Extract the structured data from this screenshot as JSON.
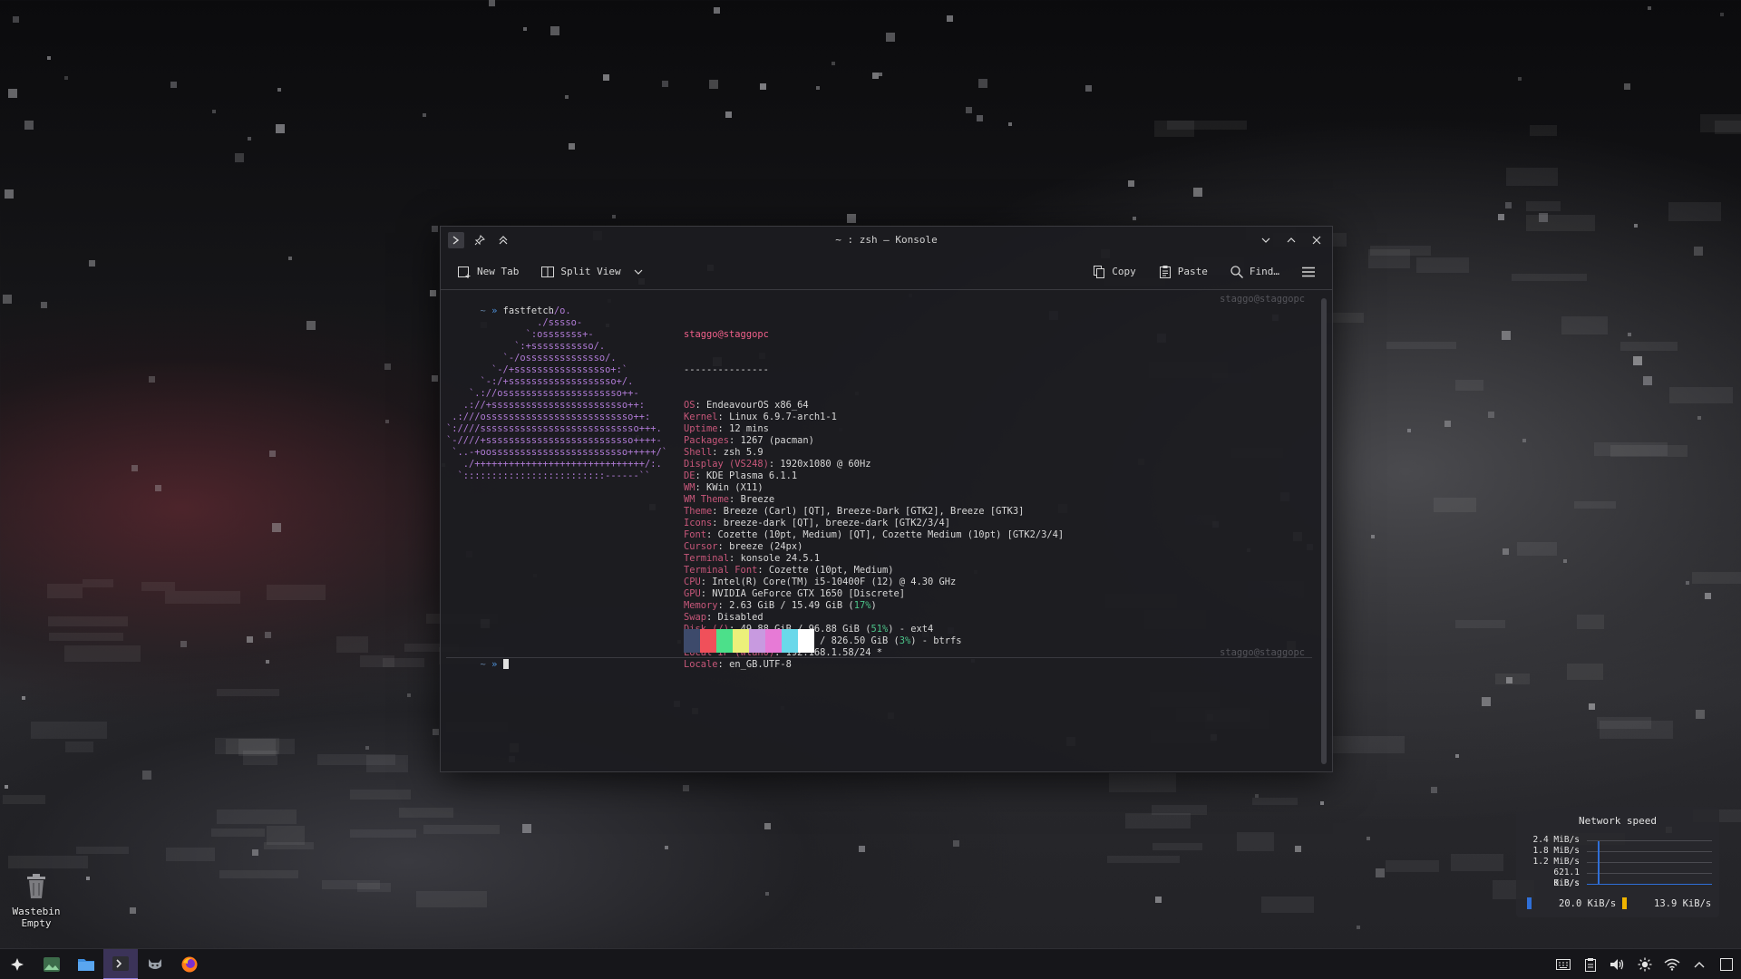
{
  "desktop": {
    "wastebin_label": "Wastebin",
    "wastebin_status": "Empty"
  },
  "window": {
    "title": "~ : zsh — Konsole",
    "toolbar": {
      "new_tab": "New Tab",
      "split_view": "Split View",
      "copy": "Copy",
      "paste": "Paste",
      "find": "Find…"
    }
  },
  "terminal": {
    "prompt_tilde": "~",
    "prompt_arrow": "»",
    "command": "fastfetch",
    "host_right": "staggo@staggopc",
    "logo_lines": [
      "                  ./o.",
      "                ./sssso-",
      "              `:osssssss+-",
      "            `:+sssssssssso/.",
      "          `-/ossssssssssssso/.",
      "        `-/+sssssssssssssssso+:`",
      "      `-:/+sssssssssssssssssso+/.",
      "    `.://osssssssssssssssssssso++-",
      "   .://+ssssssssssssssssssssssso++:",
      " .:///ossssssssssssssssssssssssso++:",
      "`:////ssssssssssssssssssssssssssso+++.",
      "`-////+ssssssssssssssssssssssssso++++-",
      " `..-+oossssssssssssssssssssssso+++++/`",
      "   ./++++++++++++++++++++++++++++++/:.",
      "  `:::::::::::::::::::::::::------``"
    ],
    "user_host": "staggo@staggopc",
    "underline": "---------------",
    "info": [
      {
        "k": "OS",
        "v": "EndeavourOS x86_64"
      },
      {
        "k": "Kernel",
        "v": "Linux 6.9.7-arch1-1"
      },
      {
        "k": "Uptime",
        "v": "12 mins"
      },
      {
        "k": "Packages",
        "v": "1267 (pacman)"
      },
      {
        "k": "Shell",
        "v": "zsh 5.9"
      },
      {
        "k": "Display (VS248)",
        "v": "1920x1080 @ 60Hz"
      },
      {
        "k": "DE",
        "v": "KDE Plasma 6.1.1"
      },
      {
        "k": "WM",
        "v": "KWin (X11)"
      },
      {
        "k": "WM Theme",
        "v": "Breeze"
      },
      {
        "k": "Theme",
        "v": "Breeze (Carl) [QT], Breeze-Dark [GTK2], Breeze [GTK3]"
      },
      {
        "k": "Icons",
        "v": "breeze-dark [QT], breeze-dark [GTK2/3/4]"
      },
      {
        "k": "Font",
        "v": "Cozette (10pt, Medium) [QT], Cozette Medium (10pt) [GTK2/3/4]"
      },
      {
        "k": "Cursor",
        "v": "breeze (24px)"
      },
      {
        "k": "Terminal",
        "v": "konsole 24.5.1"
      },
      {
        "k": "Terminal Font",
        "v": "Cozette (10pt, Medium)"
      },
      {
        "k": "CPU",
        "v": "Intel(R) Core(TM) i5-10400F (12) @ 4.30 GHz"
      },
      {
        "k": "GPU",
        "v": "NVIDIA GeForce GTX 1650 [Discrete]"
      },
      {
        "k": "Memory",
        "v": "2.63 GiB / 15.49 GiB (",
        "p": "17%",
        "after": ")"
      },
      {
        "k": "Swap",
        "v": "Disabled"
      },
      {
        "k": "Disk (/)",
        "v": "49.88 GiB / 96.88 GiB (",
        "p": "51%",
        "after": ") - ext4"
      },
      {
        "k": "Disk (/data)",
        "v": "28.21 GiB / 826.50 GiB (",
        "p": "3%",
        "after": ") - btrfs"
      },
      {
        "k": "Local IP (wlan0)",
        "v": "192.168.1.58/24 *"
      },
      {
        "k": "Locale",
        "v": "en_GB.UTF-8"
      }
    ],
    "palette_colors": [
      "#3d4a6b",
      "#f0505a",
      "#4ce08a",
      "#ecf07a",
      "#c89ae0",
      "#e77ad6",
      "#6ad8ea",
      "#ffffff"
    ]
  },
  "network_widget": {
    "title": "Network speed",
    "y_labels": [
      "2.4 MiB/s",
      "1.8 MiB/s",
      "1.2 MiB/s",
      "621.1 KiB/s",
      "0 B/s"
    ],
    "download": "20.0 KiB/s",
    "upload": "13.9 KiB/s",
    "download_color": "#2f6fd8",
    "upload_color": "#f0b400"
  },
  "taskbar": {
    "apps": [
      "app-launcher-icon",
      "image-viewer-icon",
      "file-manager-icon",
      "konsole-icon",
      "cat-app-icon",
      "firefox-icon"
    ],
    "tray": [
      "keyboard-layout-icon",
      "clipboard-icon",
      "volume-icon",
      "brightness-icon",
      "wifi-icon",
      "tray-expand-icon",
      "show-desktop-icon"
    ]
  }
}
